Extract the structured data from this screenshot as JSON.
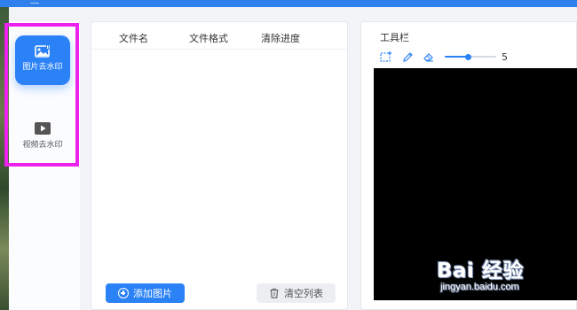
{
  "sidebar": {
    "modes": [
      {
        "label": "图片去水印",
        "icon": "image-icon",
        "active": true
      },
      {
        "label": "视频去水印",
        "icon": "play-icon",
        "active": false
      }
    ],
    "highlight_color": "#ee22ee"
  },
  "file_list": {
    "columns": [
      "文件名",
      "文件格式",
      "清除进度"
    ],
    "rows": [],
    "add_button_label": "添加图片",
    "clear_button_label": "清空列表"
  },
  "toolbar": {
    "title": "工具栏",
    "tools": [
      "rect-select-icon",
      "pen-icon",
      "eraser-icon"
    ],
    "brush_size": {
      "value": "5",
      "fill_fraction": 0.45
    }
  },
  "watermark": {
    "logo": "Bai 经验",
    "url": "jingyan.baidu.com"
  },
  "colors": {
    "accent": "#2b82f6",
    "topbar": "#2f80ed",
    "canvas": "#000000"
  }
}
